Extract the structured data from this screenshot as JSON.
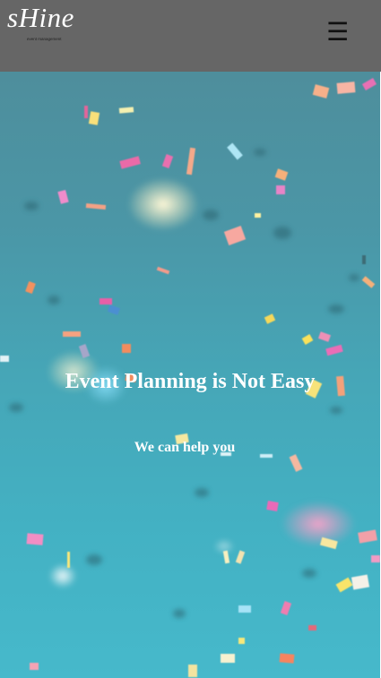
{
  "header": {
    "logo_text": "sHine",
    "logo_tagline": "event management",
    "menu_icon": "hamburger-menu-icon",
    "menu_glyph": "☰",
    "background_color": "#666666"
  },
  "hero": {
    "headline": "Event Planning is Not Easy",
    "subheadline": "We can help you",
    "background_image": "confetti-photo",
    "colors": {
      "top": "#4e8e9c",
      "bottom": "#46b9cb"
    }
  }
}
